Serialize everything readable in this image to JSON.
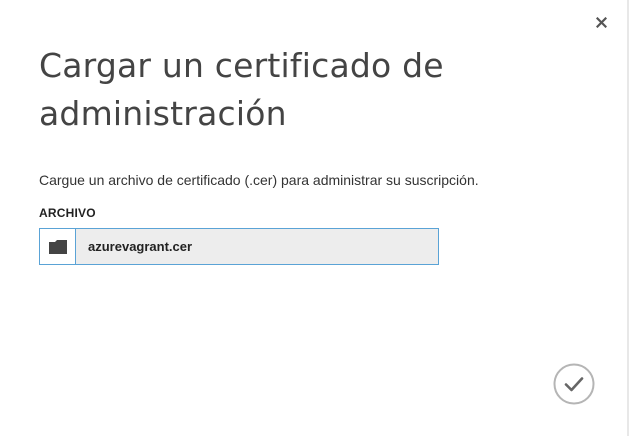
{
  "dialog": {
    "title": "Cargar un certificado de administración",
    "description": "Cargue un archivo de certificado (.cer) para administrar su suscripción.",
    "file_field": {
      "label": "ARCHIVO",
      "value": "azurevagrant.cer",
      "browse_icon": "folder-icon"
    },
    "close_icon": "close-icon",
    "confirm_icon": "checkmark-icon"
  },
  "colors": {
    "accent_border": "#5aa3d6",
    "title_text": "#444444",
    "field_background": "#ededed",
    "confirm_circle": "#b5b5b5"
  }
}
